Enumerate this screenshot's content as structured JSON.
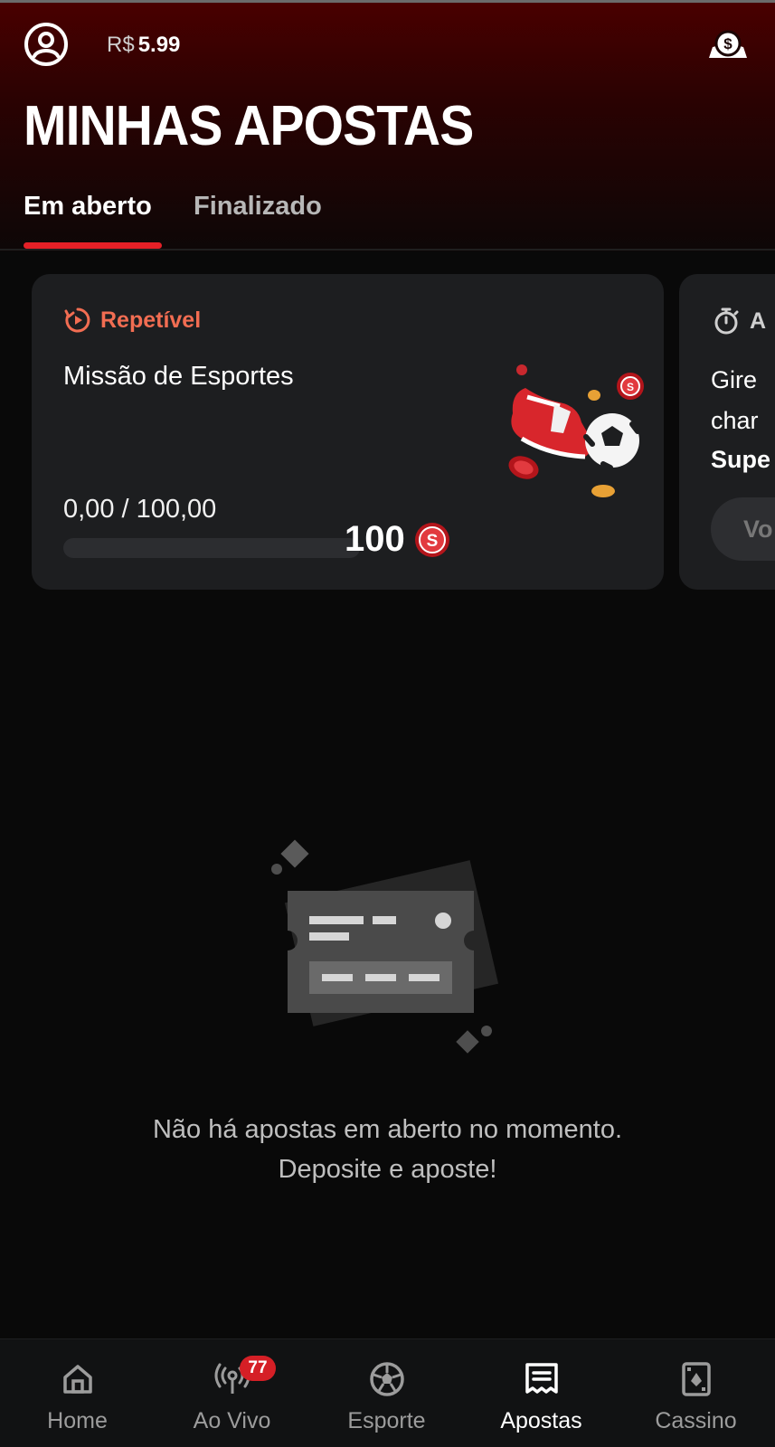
{
  "header": {
    "currency": "R$",
    "balance": "5.99",
    "title": "MINHAS APOSTAS",
    "icons": {
      "profile": "user-circle-icon",
      "cash": "cash-coin-icon"
    }
  },
  "tabs": [
    {
      "label": "Em aberto",
      "active": true
    },
    {
      "label": "Finalizado",
      "active": false
    }
  ],
  "missions": [
    {
      "badge": "Repetível",
      "badge_icon": "repeat-play-icon",
      "title": "Missão de Esportes",
      "progress_text": "0,00 / 100,00",
      "progress": 0,
      "reward": "100",
      "reward_icon": "coin-s-icon",
      "art": "soccer-cleat-ball-coins-illustration"
    },
    {
      "badge": "A",
      "badge_icon": "stopwatch-icon",
      "line1": "Gire",
      "line2": "char",
      "line3": "Supe",
      "button": "Vo"
    }
  ],
  "empty_state": {
    "line1": "Não há apostas em aberto no momento.",
    "line2": "Deposite e aposte!",
    "icon": "ticket-illustration"
  },
  "nav": [
    {
      "label": "Home",
      "icon": "home-icon",
      "active": false
    },
    {
      "label": "Ao Vivo",
      "icon": "live-broadcast-icon",
      "badge": "77",
      "active": false
    },
    {
      "label": "Esporte",
      "icon": "soccer-ball-icon",
      "active": false
    },
    {
      "label": "Apostas",
      "icon": "bet-slip-icon",
      "active": true
    },
    {
      "label": "Cassino",
      "icon": "playing-card-icon",
      "active": false
    }
  ],
  "colors": {
    "accent": "#e42027",
    "badge_orange": "#f26d52",
    "card_bg": "#1d1e20",
    "page_bg": "#090909"
  }
}
